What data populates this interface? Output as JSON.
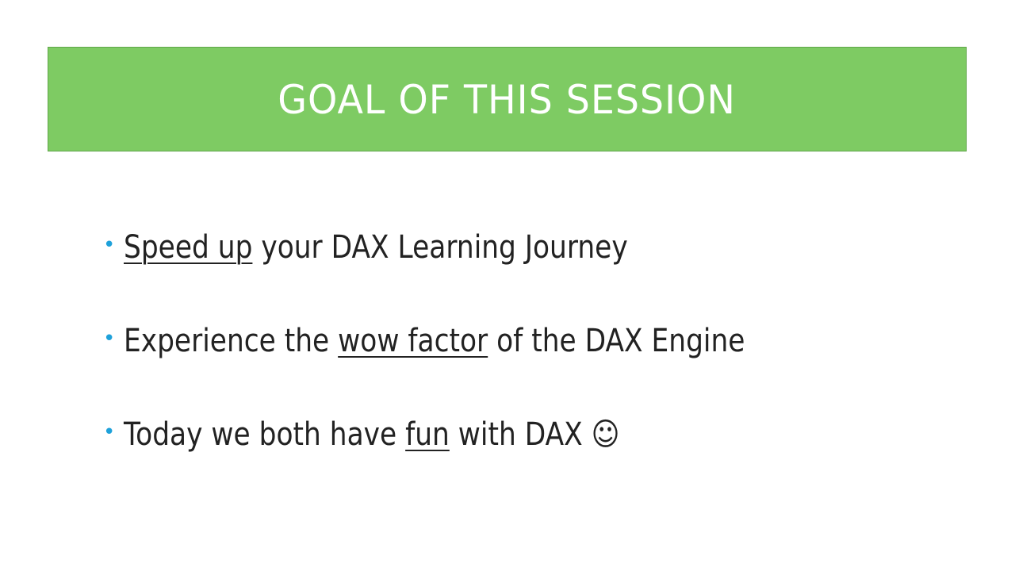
{
  "slide": {
    "title": "GOAL OF THIS SESSION",
    "colors": {
      "title_background": "#7ecb63",
      "title_text": "#ffffff",
      "bullet": "#1ea1da",
      "body_text": "#222222"
    },
    "bullets": [
      {
        "bullet": "•",
        "segments": [
          {
            "text": "Speed up",
            "underline": true
          },
          {
            "text": " your DAX Learning Journey",
            "underline": false
          }
        ]
      },
      {
        "bullet": "•",
        "segments": [
          {
            "text": "Experience the ",
            "underline": false
          },
          {
            "text": "wow factor",
            "underline": true
          },
          {
            "text": " of the DAX Engine",
            "underline": false
          }
        ]
      },
      {
        "bullet": "•",
        "segments": [
          {
            "text": "Today we both have ",
            "underline": false
          },
          {
            "text": "fun",
            "underline": true
          },
          {
            "text": " with DAX ☺",
            "underline": false
          }
        ]
      }
    ]
  }
}
